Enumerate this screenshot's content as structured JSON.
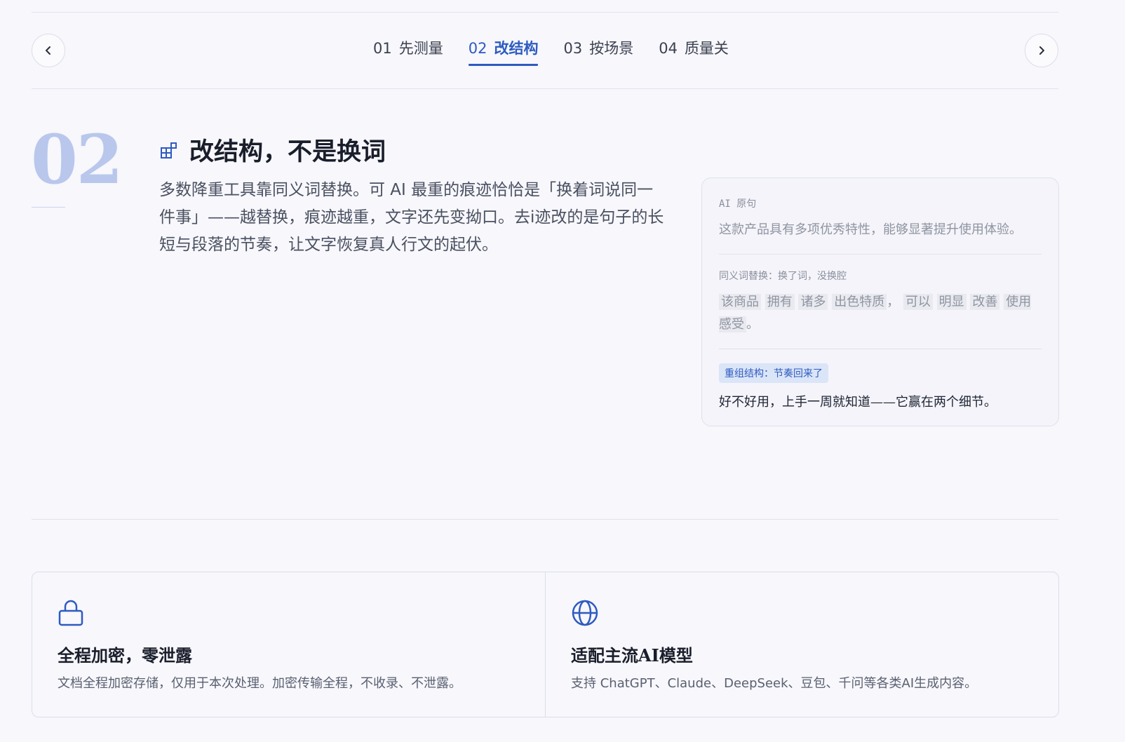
{
  "tabs": [
    {
      "num": "01",
      "label": "先测量",
      "active": false
    },
    {
      "num": "02",
      "label": "改结构",
      "active": true
    },
    {
      "num": "03",
      "label": "按场景",
      "active": false
    },
    {
      "num": "04",
      "label": "质量关",
      "active": false
    }
  ],
  "section": {
    "number": "02",
    "title": "改结构，不是换词",
    "description": "多数降重工具靠同义词替换。可 AI 最重的痕迹恰恰是「换着词说同一件事」——越替换，痕迹越重，文字还先变拗口。去i迹改的是句子的长短与段落的节奏，让文字恢复真人行文的起伏。"
  },
  "compare": {
    "original_label": "AI 原句",
    "original_text": "这款产品具有多项优秀特性，能够显著提升使用体验。",
    "synonym_label": "同义词替换：换了词，没换腔",
    "synonym_chunks": [
      "该商品",
      "拥有",
      "诸多",
      "出色特质",
      "，",
      "可以",
      "明显",
      "改善",
      "使用感受",
      "。"
    ],
    "restructure_badge": "重组结构：节奏回来了",
    "restructure_text": "好不好用，上手一周就知道——它赢在两个细节。"
  },
  "features": [
    {
      "icon": "lock-icon",
      "title": "全程加密，零泄露",
      "desc": "文档全程加密存储，仅用于本次处理。加密传输全程，不收录、不泄露。"
    },
    {
      "icon": "globe-icon",
      "title": "适配主流AI模型",
      "desc": "支持 ChatGPT、Claude、DeepSeek、豆包、千问等各类AI生成内容。"
    }
  ],
  "colors": {
    "accent": "#2e5bbf",
    "number_tint": "#b9c7ec",
    "background": "#f7f7fc"
  }
}
